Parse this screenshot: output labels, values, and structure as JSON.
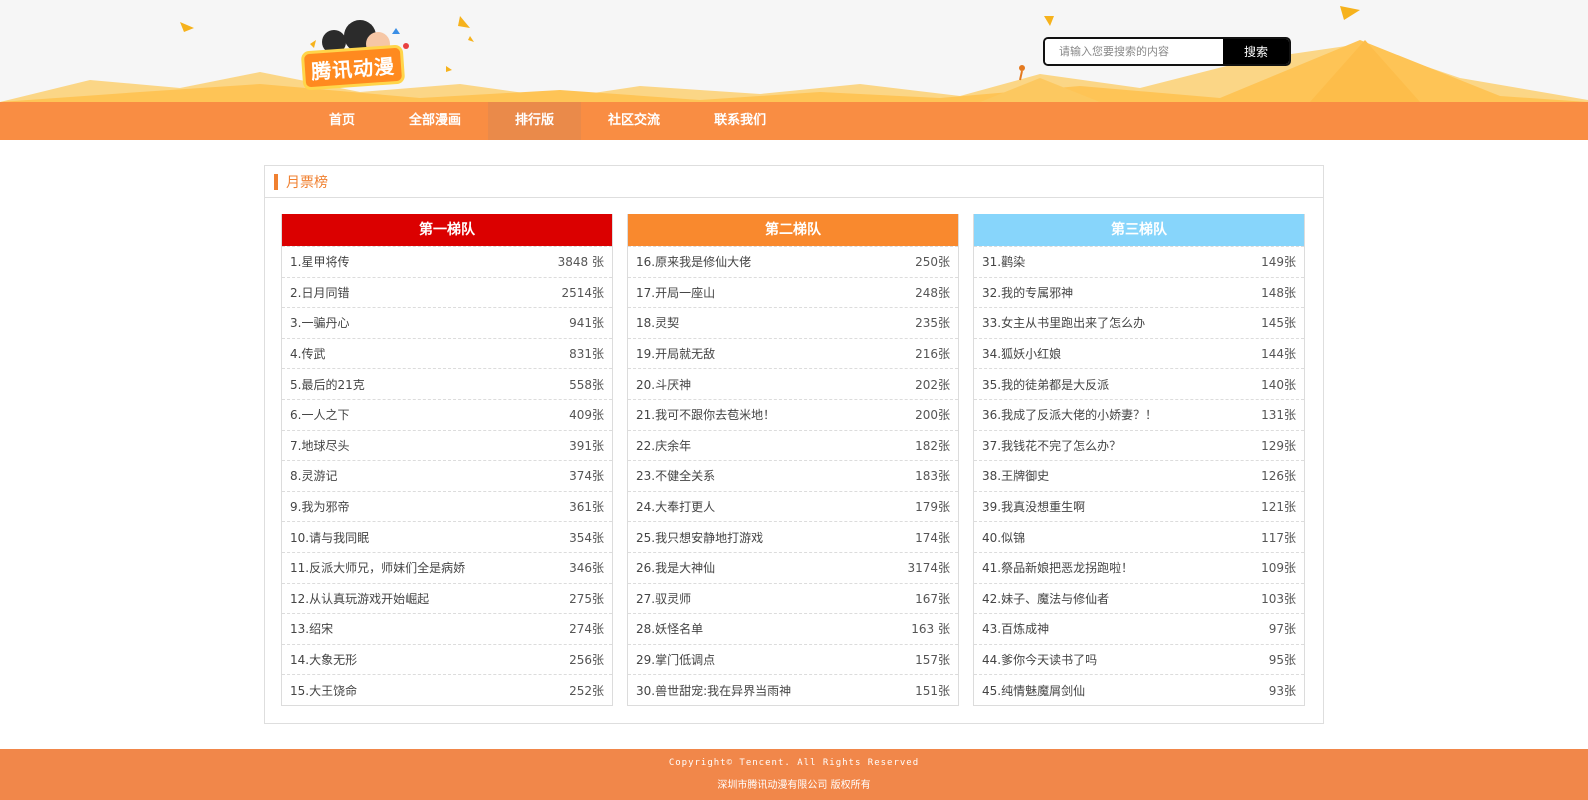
{
  "header": {
    "logo_text": "腾讯动漫",
    "search": {
      "placeholder": "请输入您要搜索的内容",
      "button": "搜索"
    }
  },
  "nav": {
    "items": [
      {
        "label": "首页",
        "active": false
      },
      {
        "label": "全部漫画",
        "active": false
      },
      {
        "label": "排行版",
        "active": true
      },
      {
        "label": "社区交流",
        "active": false
      },
      {
        "label": "联系我们",
        "active": false
      }
    ]
  },
  "panel": {
    "title": "月票榜",
    "columns": [
      {
        "title": "第一梯队",
        "color": "#db0000",
        "rows": [
          {
            "name": "1.星甲将传",
            "count": "3848 张"
          },
          {
            "name": "2.日月同错",
            "count": "2514张"
          },
          {
            "name": "3.一骗丹心",
            "count": "941张"
          },
          {
            "name": "4.传武",
            "count": "831张"
          },
          {
            "name": "5.最后的21克",
            "count": "558张"
          },
          {
            "name": "6.一人之下",
            "count": "409张"
          },
          {
            "name": "7.地球尽头",
            "count": "391张"
          },
          {
            "name": "8.灵游记",
            "count": "374张"
          },
          {
            "name": "9.我为邪帝",
            "count": "361张"
          },
          {
            "name": "10.请与我同眠",
            "count": "354张"
          },
          {
            "name": "11.反派大师兄，师妹们全是病娇",
            "count": "346张"
          },
          {
            "name": "12.从认真玩游戏开始崛起",
            "count": "275张"
          },
          {
            "name": "13.绍宋",
            "count": "274张"
          },
          {
            "name": "14.大象无形",
            "count": "256张"
          },
          {
            "name": "15.大王饶命",
            "count": "252张"
          }
        ]
      },
      {
        "title": "第二梯队",
        "color": "#f9892e",
        "rows": [
          {
            "name": "16.原来我是修仙大佬",
            "count": "250张"
          },
          {
            "name": "17.开局一座山",
            "count": "248张"
          },
          {
            "name": "18.灵契",
            "count": "235张"
          },
          {
            "name": "19.开局就无敌",
            "count": "216张"
          },
          {
            "name": "20.斗厌神",
            "count": "202张"
          },
          {
            "name": "21.我可不跟你去苞米地！",
            "count": "200张"
          },
          {
            "name": "22.庆余年",
            "count": "182张"
          },
          {
            "name": "23.不健全关系",
            "count": "183张"
          },
          {
            "name": "24.大奉打更人",
            "count": "179张"
          },
          {
            "name": "25.我只想安静地打游戏",
            "count": "174张"
          },
          {
            "name": "26.我是大神仙",
            "count": "3174张"
          },
          {
            "name": "27.驭灵师",
            "count": "167张"
          },
          {
            "name": "28.妖怪名单",
            "count": "163 张"
          },
          {
            "name": "29.掌门低调点",
            "count": "157张"
          },
          {
            "name": "30.兽世甜宠:我在异界当雨神",
            "count": "151张"
          }
        ]
      },
      {
        "title": "第三梯队",
        "color": "#87d5fb",
        "rows": [
          {
            "name": "31.鹳染",
            "count": "149张"
          },
          {
            "name": "32.我的专属邪神",
            "count": "148张"
          },
          {
            "name": "33.女主从书里跑出来了怎么办",
            "count": "145张"
          },
          {
            "name": "34.狐妖小红娘",
            "count": "144张"
          },
          {
            "name": "35.我的徒弟都是大反派",
            "count": "140张"
          },
          {
            "name": "36.我成了反派大佬的小娇妻？！",
            "count": "131张"
          },
          {
            "name": "37.我钱花不完了怎么办？",
            "count": "129张"
          },
          {
            "name": "38.王牌御史",
            "count": "126张"
          },
          {
            "name": "39.我真没想重生啊",
            "count": "121张"
          },
          {
            "name": "40.似锦",
            "count": "117张"
          },
          {
            "name": "41.祭品新娘把恶龙拐跑啦！",
            "count": "109张"
          },
          {
            "name": "42.妹子、魔法与修仙者",
            "count": "103张"
          },
          {
            "name": "43.百炼成神",
            "count": "97张"
          },
          {
            "name": "44.爹你今天读书了吗",
            "count": "95张"
          },
          {
            "name": "45.纯情魅魔屑剑仙",
            "count": "93张"
          }
        ]
      }
    ]
  },
  "footer": {
    "line1": "Copyright© Tencent. All Rights Reserved",
    "line2": "深圳市腾讯动漫有限公司 版权所有"
  }
}
